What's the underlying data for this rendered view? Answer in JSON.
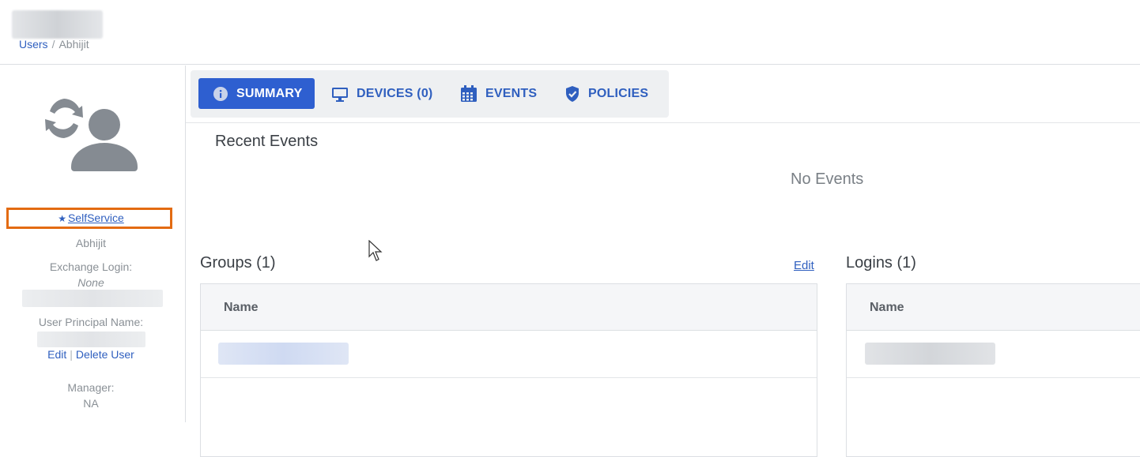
{
  "breadcrumb": {
    "root": "Users",
    "separator": "/",
    "current": "Abhijit"
  },
  "profile": {
    "avatar_icon": "user-sync-icon",
    "selfservice_star": "★",
    "selfservice_label": "SelfService",
    "display_name": "Abhijit",
    "exchange_login_label": "Exchange Login:",
    "exchange_login_value": "None",
    "upn_label": "User Principal Name:",
    "edit_label": "Edit",
    "link_separator": "|",
    "delete_label": "Delete User",
    "manager_label": "Manager:",
    "manager_value": "NA"
  },
  "tabs": [
    {
      "label": "SUMMARY",
      "icon": "info-icon",
      "active": true
    },
    {
      "label": "DEVICES (0)",
      "icon": "monitor-icon",
      "active": false
    },
    {
      "label": "EVENTS",
      "icon": "calendar-icon",
      "active": false
    },
    {
      "label": "POLICIES",
      "icon": "shield-check-icon",
      "active": false
    }
  ],
  "recent_events": {
    "title": "Recent Events",
    "empty_text": "No Events"
  },
  "groups": {
    "title": "Groups (1)",
    "edit_label": "Edit",
    "column": "Name"
  },
  "logins": {
    "title": "Logins (1)",
    "column": "Name"
  },
  "colors": {
    "accent": "#2e5fd0",
    "link": "#2f5fbf",
    "highlight": "#e36b12"
  }
}
